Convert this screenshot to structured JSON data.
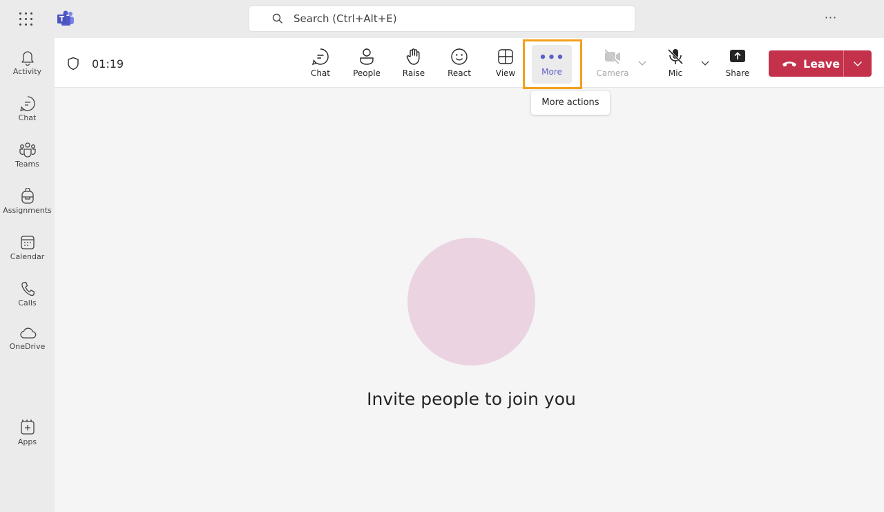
{
  "titlebar": {
    "search_placeholder": "Search (Ctrl+Alt+E)",
    "more_label": "···"
  },
  "rail": {
    "items": [
      {
        "label": "Activity",
        "icon": "bell-icon"
      },
      {
        "label": "Chat",
        "icon": "chat-icon"
      },
      {
        "label": "Teams",
        "icon": "teams-icon"
      },
      {
        "label": "Assignments",
        "icon": "backpack-icon"
      },
      {
        "label": "Calendar",
        "icon": "calendar-icon"
      },
      {
        "label": "Calls",
        "icon": "phone-icon"
      },
      {
        "label": "OneDrive",
        "icon": "cloud-icon"
      },
      {
        "label": "Apps",
        "icon": "add-square-icon"
      }
    ],
    "more": "···"
  },
  "meeting": {
    "timer": "01:19",
    "toolbar": {
      "chat": "Chat",
      "people": "People",
      "raise": "Raise",
      "react": "React",
      "view": "View",
      "more": "More",
      "more_dots": "•••",
      "camera": "Camera",
      "mic": "Mic",
      "share": "Share",
      "leave": "Leave"
    },
    "tooltip": "More actions",
    "invite_text": "Invite people to join you"
  },
  "colors": {
    "accent": "#5b5fc7",
    "leave": "#c4314b",
    "highlight": "#f2a01c",
    "avatar": "#ebd3e1"
  }
}
